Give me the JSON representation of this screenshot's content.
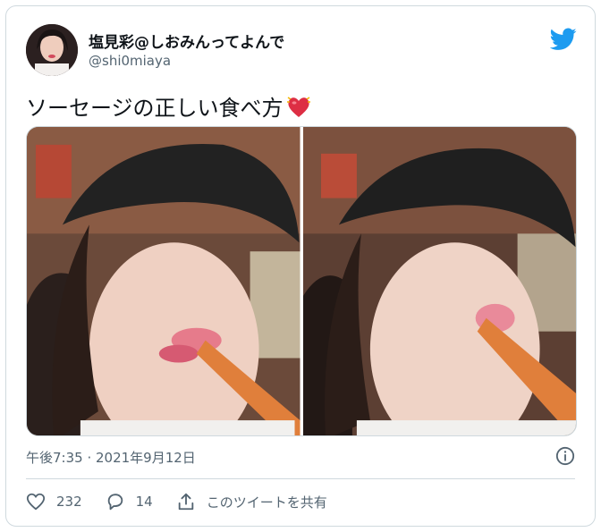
{
  "author": {
    "display_name": "塩見彩@しおみんってよんで",
    "handle": "@shi0miaya",
    "avatar_icon": "profile-photo"
  },
  "tweet": {
    "text": "ソーセージの正しい食べ方",
    "emoji_icon": "beating-heart-emoji",
    "media_count": 2
  },
  "meta": {
    "timestamp": "午後7:35 · 2021年9月12日"
  },
  "actions": {
    "like_count": "232",
    "reply_count": "14",
    "share_label": "このツイートを共有"
  },
  "colors": {
    "brand": "#1d9bf0",
    "muted_text": "#536471",
    "border": "#cfd9de",
    "heart": "#e0245e"
  }
}
